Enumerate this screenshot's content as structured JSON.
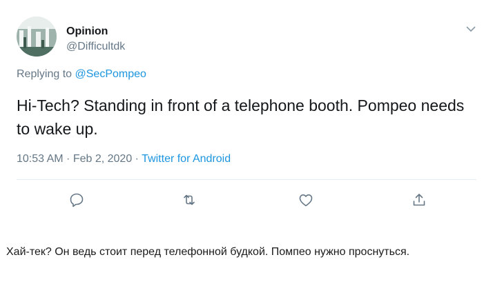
{
  "tweet": {
    "author_name": "Opinion",
    "author_handle": "@Difficultdk",
    "replying_prefix": "Replying to ",
    "replying_to": "@SecPompeo",
    "text": "Hi-Tech? Standing in front of a telephone booth. Pompeo needs to wake up.",
    "time": "10:53 AM",
    "separator1": " · ",
    "date": "Feb 2, 2020",
    "separator2": " · ",
    "source": "Twitter for Android",
    "actions": [
      {
        "icon": "reply-icon"
      },
      {
        "icon": "retweet-icon"
      },
      {
        "icon": "like-icon"
      },
      {
        "icon": "share-icon"
      }
    ]
  },
  "translation": "Хай-тек? Он ведь стоит перед телефонной будкой. Помпео нужно проснуться.",
  "colors": {
    "text": "#14171a",
    "muted": "#657786",
    "link": "#1b95e0",
    "divider": "#e6ecf0"
  }
}
